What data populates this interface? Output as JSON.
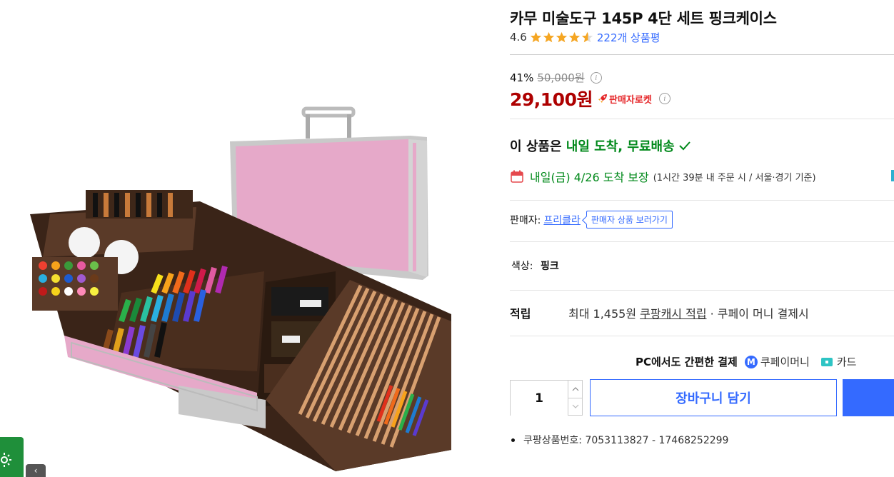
{
  "product": {
    "title": "카무 미술도구 145P 4단 세트 핑크케이스",
    "rating": "4.6",
    "rating_value": 4.6,
    "review_count": "222개 상품평"
  },
  "price": {
    "discount": "41%",
    "original": "50,000원",
    "sale": "29,100원",
    "badge": "판매자로켓"
  },
  "delivery": {
    "prefix": "이 상품은 ",
    "highlight": "내일 도착, 무료배송",
    "arrival": "내일(금) 4/26 도착 보장",
    "arrival_note": "(1시간 39분  내 주문 시 / 서울·경기 기준)"
  },
  "seller": {
    "label": "판매자:",
    "name": "프리클라",
    "button": "판매자 상품 보러가기"
  },
  "option": {
    "label": "색상:",
    "value": "핑크"
  },
  "points": {
    "label": "적립",
    "text_before": "최대 1,455원 ",
    "link": "쿠팡캐시 적립",
    "text_after": " · 쿠페이 머니 결제시"
  },
  "payment": {
    "title": "PC에서도 간편한 결제",
    "cpay_icon": "M",
    "option1": "쿠페이머니",
    "option2": "카드"
  },
  "purchase": {
    "quantity": "1",
    "cart_button": "장바구니 담기"
  },
  "product_id": "쿠팡상품번호: 7053113827 - 17468252299",
  "colors": {
    "brand_blue": "#346aff",
    "price_red": "#ae0000",
    "delivery_green": "#00891a",
    "star_yellow": "#f5a623"
  },
  "icons": [
    "star-icon",
    "info-icon",
    "rocket-icon",
    "check-icon",
    "calendar-icon",
    "cpay-icon",
    "card-icon",
    "stepper-up-icon",
    "stepper-down-icon",
    "sun-icon",
    "chevron-left-icon"
  ]
}
